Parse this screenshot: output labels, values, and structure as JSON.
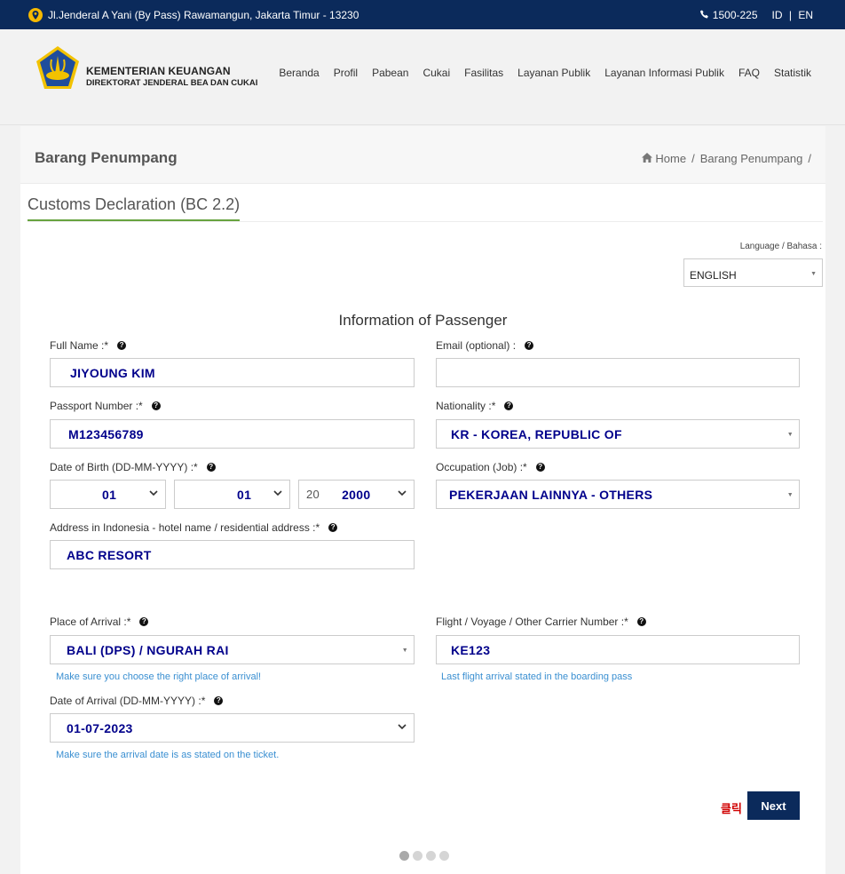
{
  "topbar": {
    "address": "Jl.Jenderal A Yani (By Pass) Rawamangun, Jakarta Timur - 13230",
    "phone": "1500-225",
    "lang_id": "ID",
    "lang_sep": "|",
    "lang_en": "EN"
  },
  "brand": {
    "line1": "KEMENTERIAN KEUANGAN",
    "line2": "DIREKTORAT JENDERAL BEA DAN CUKAI"
  },
  "nav": [
    "Beranda",
    "Profil",
    "Pabean",
    "Cukai",
    "Fasilitas",
    "Layanan Publik",
    "Layanan Informasi Publik",
    "FAQ",
    "Statistik"
  ],
  "page": {
    "title": "Barang Penumpang",
    "breadcrumb_home": "Home",
    "breadcrumb_sep": "/",
    "breadcrumb_current": "Barang Penumpang",
    "breadcrumb_trail": "/"
  },
  "section": {
    "title": "Customs Declaration (BC 2.2)"
  },
  "language": {
    "label": "Language / Bahasa :",
    "value": "ENGLISH"
  },
  "form": {
    "heading": "Information of Passenger",
    "full_name": {
      "label": "Full Name :*",
      "value": "JIYOUNG KIM"
    },
    "email": {
      "label": "Email (optional) :",
      "value": ""
    },
    "passport": {
      "label": "Passport Number :*",
      "value": "M123456789"
    },
    "nationality": {
      "label": "Nationality :*",
      "value": "KR - KOREA, REPUBLIC OF"
    },
    "dob": {
      "label": "Date of Birth (DD-MM-YYYY) :*",
      "day": "01",
      "month": "01",
      "year_prefix": "20",
      "year": "2000"
    },
    "occupation": {
      "label": "Occupation (Job) :*",
      "value": "PEKERJAAN LAINNYA - OTHERS"
    },
    "address": {
      "label": "Address in Indonesia - hotel name / residential address :*",
      "value": "ABC RESORT"
    },
    "arrival_place": {
      "label": "Place of Arrival :*",
      "value": "BALI (DPS) / NGURAH RAI",
      "hint": "Make sure you choose the right place of arrival!"
    },
    "flight": {
      "label": "Flight / Voyage / Other Carrier Number :*",
      "value": "KE123",
      "hint": "Last flight arrival stated in the boarding pass"
    },
    "arrival_date": {
      "label": "Date of Arrival (DD-MM-YYYY) :*",
      "value": "01-07-2023",
      "hint": "Make sure the arrival date is as stated on the ticket."
    }
  },
  "actions": {
    "click_note": "클릭",
    "next": "Next"
  },
  "steps": {
    "total": 4,
    "current": 1
  },
  "icons": {
    "help": "?",
    "home": "home-icon",
    "phone": "phone-icon",
    "pin": "location-pin-icon"
  }
}
